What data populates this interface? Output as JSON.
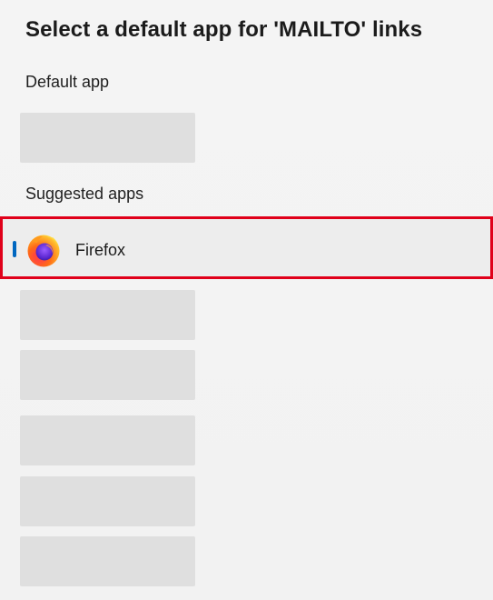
{
  "dialog": {
    "title": "Select a default app for 'MAILTO' links"
  },
  "default_section": {
    "label": "Default app"
  },
  "suggested_section": {
    "label": "Suggested apps",
    "apps": [
      {
        "name": "Firefox",
        "icon": "firefox-icon"
      }
    ]
  },
  "colors": {
    "selection_accent": "#0067c0",
    "highlight_border": "#e0001a",
    "placeholder": "#dfdfdf",
    "background": "#f3f3f3"
  }
}
